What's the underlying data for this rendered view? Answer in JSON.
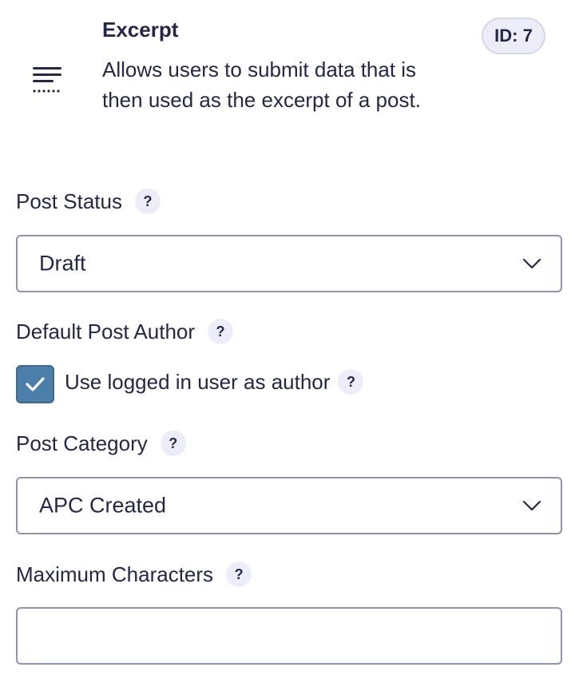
{
  "field": {
    "title": "Excerpt",
    "description": "Allows users to submit data that is then used as the excerpt of a post.",
    "id_badge": "ID: 7",
    "icon": "text-excerpt-icon"
  },
  "post_status": {
    "label": "Post Status",
    "help": "?",
    "selected": "Draft"
  },
  "default_post_author": {
    "label": "Default Post Author",
    "help": "?",
    "checkbox_label": "Use logged in user as author",
    "checkbox_help": "?",
    "checked": true
  },
  "post_category": {
    "label": "Post Category",
    "help": "?",
    "selected": "APC Created"
  },
  "maximum_characters": {
    "label": "Maximum Characters",
    "help": "?",
    "value": ""
  },
  "colors": {
    "text": "#242748",
    "checkbox": "#4c7eaa",
    "badge_bg": "#ecedf8",
    "border": "#9092b2"
  }
}
